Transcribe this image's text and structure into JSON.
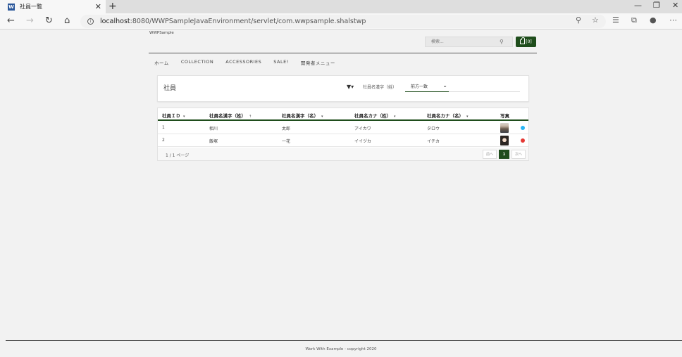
{
  "browser": {
    "tab_title": "社員一覧",
    "tab_favicon": "W",
    "url_host": "localhost",
    "url_path": ":8080/WWPSampleJavaEnvironment/servlet/com.wwpsample.shalstwp"
  },
  "site": {
    "title": "WWPSample",
    "search_placeholder": "検索...",
    "cart_count": "[0]"
  },
  "nav": {
    "items": [
      "ホーム",
      "COLLECTION",
      "ACCESSORIES",
      "SALE!",
      "開発者メニュー"
    ]
  },
  "filter": {
    "panel_title": "社員",
    "field_label": "社員名漢字（姓）",
    "operator": "前方一致"
  },
  "grid": {
    "columns": [
      {
        "label": "社員ＩＤ",
        "sort": "▾"
      },
      {
        "label": "社員名漢字（姓）",
        "sort": "↑"
      },
      {
        "label": "社員名漢字（名）",
        "sort": "▾"
      },
      {
        "label": "社員名カナ（姓）",
        "sort": "▾"
      },
      {
        "label": "社員名カナ（名）",
        "sort": "▾"
      },
      {
        "label": "写真",
        "sort": ""
      }
    ],
    "rows": [
      {
        "id": "1",
        "sei": "相川",
        "mei": "太郎",
        "kana_sei": "アイカワ",
        "kana_mei": "タロウ",
        "status_color": "#29b6f6"
      },
      {
        "id": "2",
        "sei": "飯塚",
        "mei": "一花",
        "kana_sei": "イイヅカ",
        "kana_mei": "イチカ",
        "status_color": "#e53935"
      }
    ],
    "pager_info": "1 / 1 ページ",
    "prev_label": "前へ",
    "current_page": "1",
    "next_label": "次へ"
  },
  "footer": {
    "text": "Work With Example - copyright 2020"
  },
  "colors": {
    "accent": "#1f4d1c"
  }
}
